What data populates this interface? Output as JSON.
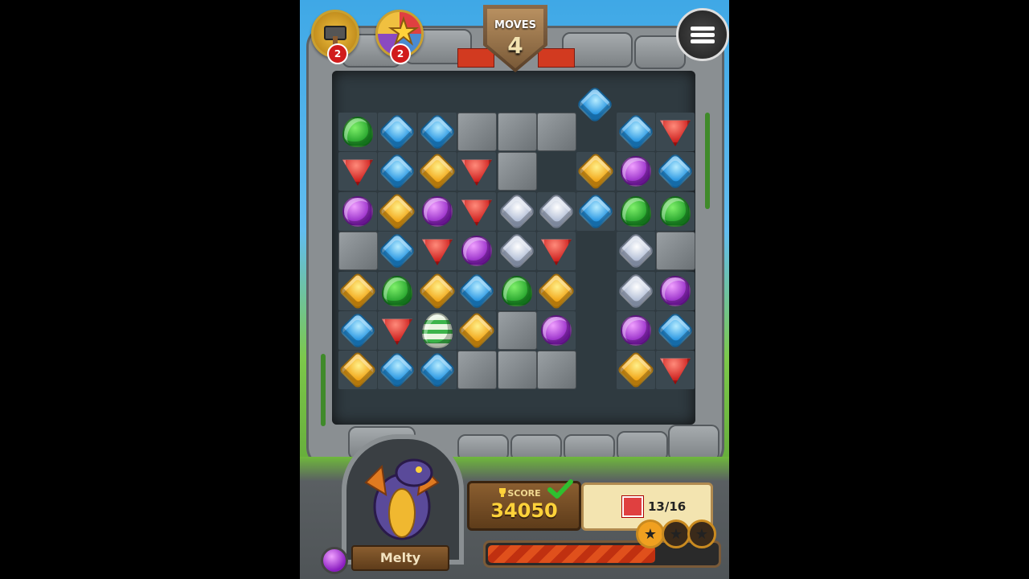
{
  "hud": {
    "moves_label": "MOVES",
    "moves_value": "4",
    "boosters": [
      {
        "name": "hammer",
        "count": "2"
      },
      {
        "name": "star-orb",
        "count": "2"
      }
    ],
    "menu_icon": "hamburger-menu-icon"
  },
  "board": {
    "rows": [
      [
        "green",
        "blue",
        "blue",
        "rock",
        "rock",
        "rock",
        "empty",
        "blue",
        "red"
      ],
      [
        "red",
        "blue",
        "yellow",
        "red",
        "rock",
        "empty",
        "yellow",
        "purple",
        "blue"
      ],
      [
        "purple",
        "yellow",
        "purple",
        "red",
        "white",
        "white",
        "blue",
        "green",
        "green"
      ],
      [
        "rock",
        "blue",
        "red",
        "purple",
        "white",
        "red",
        "empty",
        "white",
        "rock"
      ],
      [
        "yellow",
        "green",
        "yellow",
        "blue",
        "green",
        "yellow",
        "empty",
        "white",
        "purple"
      ],
      [
        "blue",
        "red",
        "egg",
        "yellow",
        "rock",
        "purple",
        "empty",
        "purple",
        "blue"
      ],
      [
        "yellow",
        "blue",
        "blue",
        "rock",
        "rock",
        "rock",
        "empty",
        "yellow",
        "red"
      ]
    ],
    "falling_gem": "blue",
    "colors": {
      "green": "#1a9a25",
      "blue": "#1c8fe0",
      "red": "#c51010",
      "yellow": "#f0a010",
      "purple": "#8a1cc0",
      "white": "#a6b4d0"
    }
  },
  "footer": {
    "score_label": "SCORE",
    "score_value": "34050",
    "goal_text": "13/16",
    "goal_progress": 0.8125,
    "character_name": "Melty",
    "stars_earned": 1,
    "stars_total": 3
  }
}
